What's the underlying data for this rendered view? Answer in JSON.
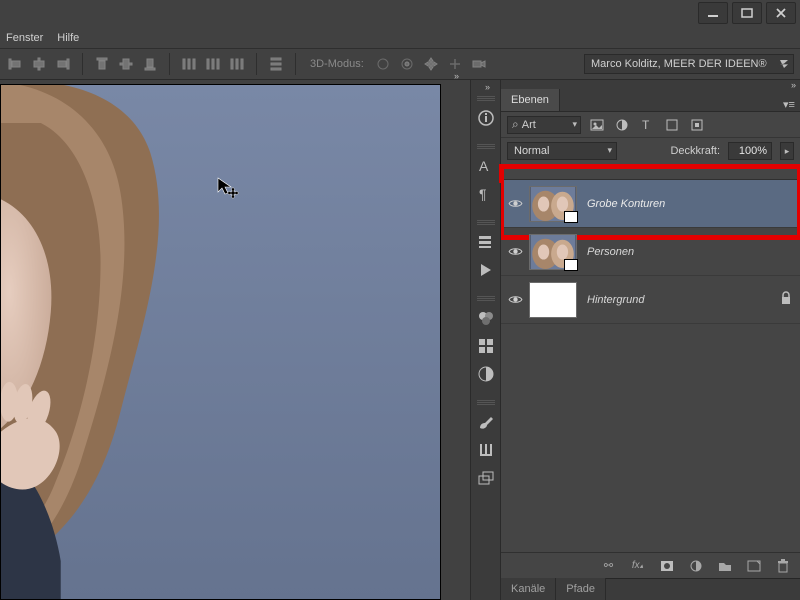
{
  "menu": {
    "fenster": "Fenster",
    "hilfe": "Hilfe"
  },
  "optionsbar": {
    "mode3d_label": "3D-Modus:",
    "workspace": "Marco Kolditz, MEER DER IDEEN®"
  },
  "panels": {
    "ebenen_tab": "Ebenen",
    "search_label": "Art",
    "blend_mode": "Normal",
    "opacity_label": "Deckkraft:",
    "opacity_value": "100%"
  },
  "layers": [
    {
      "name": "Grobe Konturen",
      "visible": true,
      "selected": true,
      "thumb": "photo",
      "locked": false
    },
    {
      "name": "Personen",
      "visible": true,
      "selected": false,
      "thumb": "photo",
      "locked": false
    },
    {
      "name": "Hintergrund",
      "visible": true,
      "selected": false,
      "thumb": "white",
      "locked": true
    }
  ],
  "footer_icons": [
    "link-icon",
    "fx-icon",
    "mask-icon",
    "adjust-icon",
    "group-icon",
    "new-layer-icon",
    "trash-icon"
  ],
  "bottom_tabs": {
    "kanaele": "Kanäle",
    "pfade": "Pfade"
  }
}
